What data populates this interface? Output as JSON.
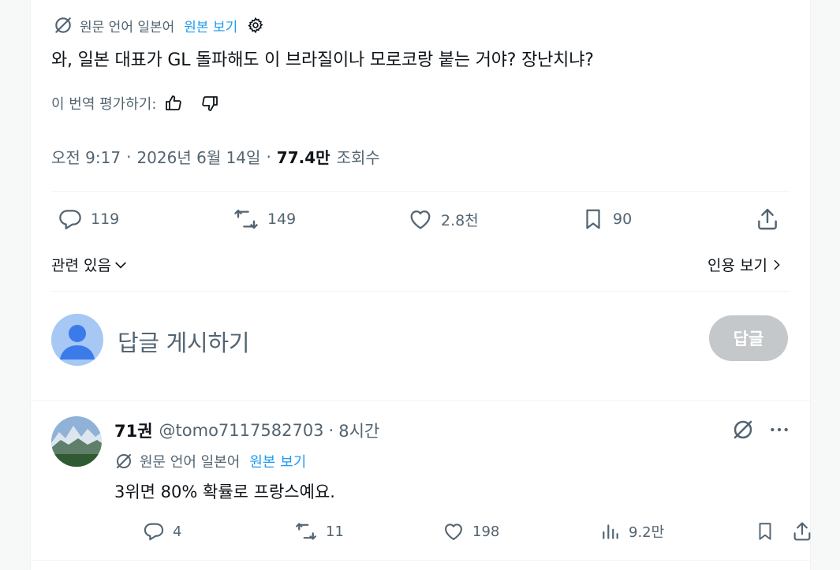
{
  "main_tweet": {
    "translation": {
      "prefix": "원문 언어 일본어",
      "link": "원본 보기"
    },
    "text": "와, 일본 대표가 GL 돌파해도 이 브라질이나 모로코랑 붙는 거야? 장난치냐?",
    "rate_label": "이 번역 평가하기:",
    "meta": {
      "time": "오전 9:17",
      "date": "2026년 6월 14일",
      "views_count": "77.4만",
      "views_label": "조회수"
    },
    "actions": {
      "replies": "119",
      "retweets": "149",
      "likes": "2.8천",
      "bookmarks": "90"
    },
    "related_label": "관련 있음",
    "quotes_label": "인용 보기"
  },
  "reply_composer": {
    "placeholder": "답글 게시하기",
    "button_label": "답글"
  },
  "reply": {
    "display_name": "71권",
    "handle": "@tomo7117582703",
    "time": "8시간",
    "translation": {
      "prefix": "원문 언어 일본어",
      "link": "원본 보기"
    },
    "text": "3위면 80% 확률로 프랑스예요.",
    "actions": {
      "replies": "4",
      "retweets": "11",
      "likes": "198",
      "views": "9.2만"
    }
  },
  "colors": {
    "link": "#1d9bf0",
    "muted": "#536471",
    "text": "#0f1419",
    "disabled_button": "#c4c8cb"
  }
}
